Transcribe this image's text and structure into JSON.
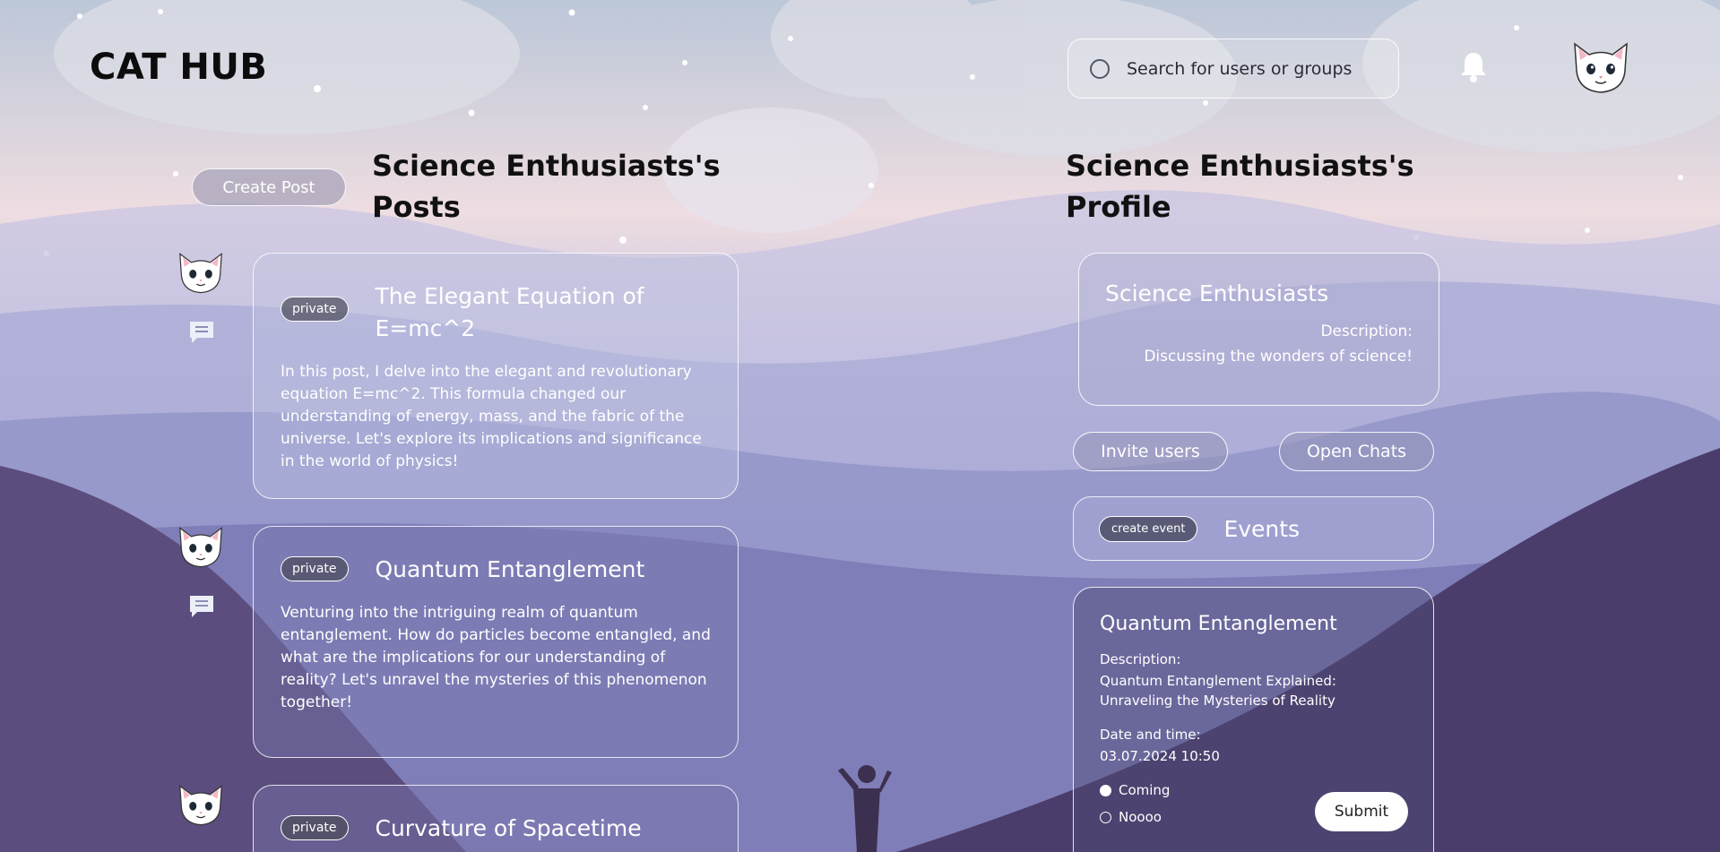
{
  "header": {
    "logo": "CAT HUB",
    "search_placeholder": "Search for users or groups",
    "notification_icon": "bell-icon",
    "avatar_icon": "cat-avatar-icon"
  },
  "posts_section": {
    "title": "Science Enthusiasts's Posts",
    "create_post_label": "Create Post",
    "posts": [
      {
        "visibility": "private",
        "title": "The Elegant Equation of E=mc^2",
        "body": "In this post, I delve into the elegant and revolutionary equation E=mc^2. This formula changed our understanding of energy, mass, and the fabric of the universe. Let's explore its implications and significance in the world of physics!"
      },
      {
        "visibility": "private",
        "title": "Quantum Entanglement",
        "body": "Venturing into the intriguing realm of quantum entanglement. How do particles become entangled, and what are the implications for our understanding of reality? Let's unravel the mysteries of this phenomenon together!"
      },
      {
        "visibility": "private",
        "title": "Curvature of Spacetime",
        "body": ""
      }
    ]
  },
  "profile_section": {
    "title": "Science Enthusiasts's Profile",
    "group_name": "Science Enthusiasts",
    "description_label": "Description:",
    "description": "Discussing the wonders of science!",
    "invite_label": "Invite users",
    "open_chats_label": "Open Chats",
    "create_event_label": "create event",
    "events_title": "Events",
    "event": {
      "title": "Quantum Entanglement",
      "description_label": "Description:",
      "description": "Quantum Entanglement Explained: Unraveling the Mysteries of Reality",
      "datetime_label": "Date and time:",
      "datetime": "03.07.2024 10:50",
      "options": [
        "Coming",
        "Noooo"
      ],
      "selected_option": "Coming",
      "submit_label": "Submit"
    }
  }
}
